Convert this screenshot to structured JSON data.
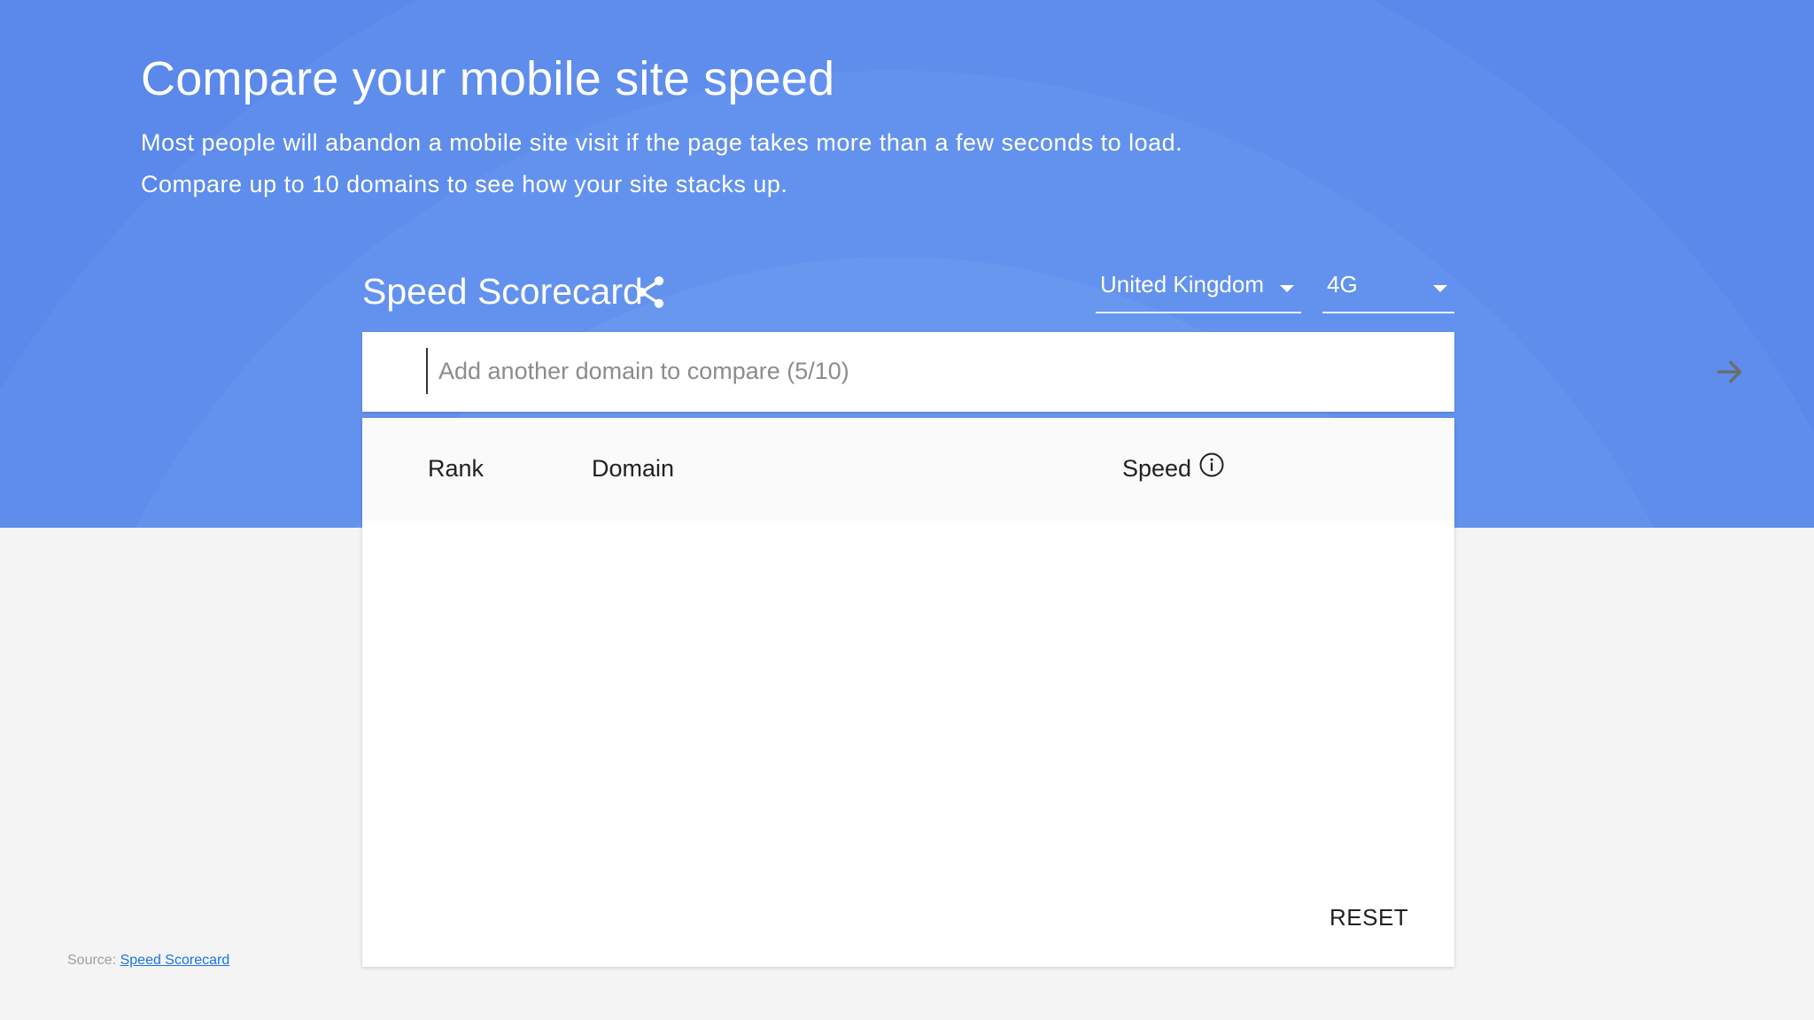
{
  "hero": {
    "title": "Compare your mobile site speed",
    "description": "Most people will abandon a mobile site visit if the page takes more than a few seconds to load. Compare up to 10 domains to see how your site stacks up."
  },
  "scorecard": {
    "title": "Speed Scorecard",
    "share_icon": "share-icon",
    "country_select": {
      "value": "United Kingdom"
    },
    "network_select": {
      "value": "4G"
    },
    "search": {
      "placeholder": "Add another domain to compare (5/10)",
      "submit_icon": "arrow-right-icon"
    },
    "table": {
      "headers": {
        "rank": "Rank",
        "domain": "Domain",
        "speed": "Speed"
      },
      "speed_info_icon": "info-icon",
      "rows": []
    },
    "reset_label": "RESET"
  },
  "footer": {
    "source_prefix": "Source:",
    "source_link": "Speed Scorecard"
  },
  "colors": {
    "hero_blue": "#5a89eb",
    "page_background": "#f4f4f5",
    "card_background": "#ffffff",
    "link": "#1a73e8"
  }
}
